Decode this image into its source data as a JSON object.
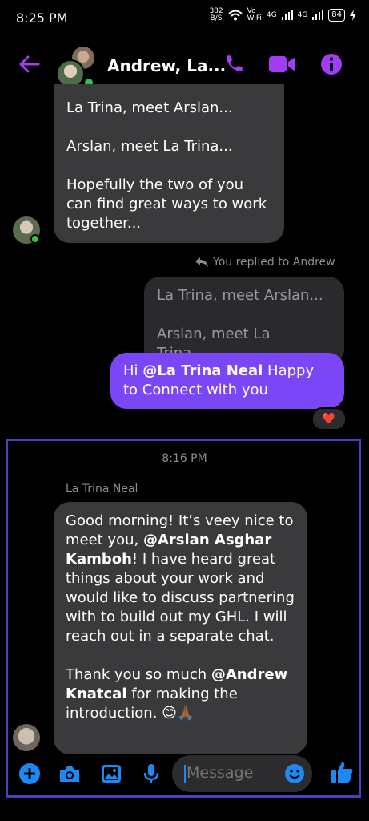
{
  "status_bar": {
    "time": "8:25 PM",
    "net_speed": "382\nB/S",
    "volte": "Vo\nWiFi",
    "sig1": "4G",
    "sig2": "4G",
    "battery": "84"
  },
  "header": {
    "title": "Andrew, La...",
    "accent": "#a33cf5"
  },
  "messages": {
    "first_lines": [
      "La Trina, meet Arslan...",
      "Arslan, meet La Trina...",
      "Hopefully the two of you can find great ways to work together..."
    ],
    "replied_label": "You replied to Andrew",
    "reply_quote_1": "La Trina, meet Arslan...",
    "reply_quote_2": "Arslan, meet La Trina......",
    "outgoing_prefix": "Hi ",
    "outgoing_mention": "@La Trina Neal",
    "outgoing_suffix": " Happy to Connect with you",
    "reaction": "❤️",
    "timestamp": "8:16 PM",
    "sender_name": "La Trina Neal",
    "incoming_p1_a": "Good morning!  It’s veey nice to meet you, ",
    "incoming_mention1": "@Arslan Asghar Kamboh",
    "incoming_p1_b": "!  I have heard great things about your work and would like to discuss partnering with to build out my GHL.  I will reach out in a separate chat.",
    "incoming_p2_a": "Thank you so much ",
    "incoming_mention2": "@Andrew Knatcal",
    "incoming_p2_b": " for making the introduction. 😊🙏🏾"
  },
  "composer": {
    "placeholder": "Message",
    "accent": "#1e88f5"
  }
}
